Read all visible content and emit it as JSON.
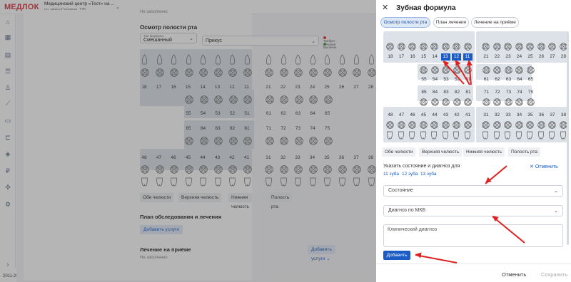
{
  "app": {
    "logo": "МЕДЛОК",
    "clinic": "Медицинский центр «Тест» на ...",
    "clinic_addr": "ул. Ново-Садовая, 135",
    "footer": "2011-2026 © медрокет"
  },
  "bg": {
    "not_filled_top": "Не заполнено",
    "exam_title": "Осмотр полости рта",
    "formula_type_label": "Тип формулы",
    "formula_type_value": "Смешанный",
    "bite_value": "Прикус",
    "legend_required": "Требует лечения",
    "legend_extracted": "Выпечен",
    "legend_colors": {
      "required": "#e0303a",
      "extracted": "#3aa047"
    },
    "upper_perm": [
      "18",
      "17",
      "16",
      "15",
      "14",
      "13",
      "12",
      "11",
      "21",
      "22",
      "23",
      "24",
      "25",
      "26",
      "27",
      "28"
    ],
    "upper_milk": [
      "55",
      "54",
      "53",
      "52",
      "51",
      "61",
      "62",
      "63",
      "64",
      "65"
    ],
    "lower_milk": [
      "85",
      "84",
      "83",
      "82",
      "81",
      "71",
      "72",
      "73",
      "74",
      "75"
    ],
    "lower_perm": [
      "48",
      "47",
      "46",
      "45",
      "44",
      "43",
      "42",
      "41",
      "31",
      "32",
      "33",
      "34",
      "35",
      "36",
      "37",
      "38"
    ],
    "jaw_buttons": [
      "Обе челюсти",
      "Верхняя челюсть",
      "Нижняя челюсть",
      "Полость рта"
    ],
    "plan_title": "План обследования и лечения",
    "add_services": "Добавить услуги",
    "treatment_title": "Лечение на приёме",
    "add_services2": "Добавить услуги",
    "not_filled": "Не заполнено"
  },
  "panel": {
    "title": "Зубная формула",
    "tabs": [
      "Осмотр полости рта",
      "План лечения",
      "Лечение на приёме"
    ],
    "upper_perm": [
      "18",
      "17",
      "16",
      "15",
      "14",
      "13",
      "12",
      "11",
      "21",
      "22",
      "23",
      "24",
      "25",
      "26",
      "27",
      "28"
    ],
    "upper_milk": [
      "55",
      "54",
      "53",
      "52",
      "51",
      "61",
      "62",
      "63",
      "64",
      "65"
    ],
    "lower_milk": [
      "85",
      "84",
      "83",
      "82",
      "81",
      "71",
      "72",
      "73",
      "74",
      "75"
    ],
    "lower_perm": [
      "48",
      "47",
      "46",
      "45",
      "44",
      "43",
      "42",
      "41",
      "31",
      "32",
      "33",
      "34",
      "35",
      "36",
      "37",
      "38"
    ],
    "selected_teeth": [
      "13",
      "12",
      "11"
    ],
    "jaw_buttons": [
      "Обе челюсти",
      "Верхняя челюсть",
      "Нижняя челюсть",
      "Полость рта"
    ],
    "state_heading": "Указать состояние и диагноз для",
    "reset": "Отменить",
    "chips": [
      "11 зуба",
      "12 зуба",
      "13 зуба"
    ],
    "state_placeholder": "Состояние",
    "mkb_placeholder": "Диагноз по МКБ",
    "clinical_placeholder": "Клинический диагноз",
    "add": "Добавить",
    "cancel": "Отменить",
    "save": "Сохранить"
  },
  "colors": {
    "accent": "#1b5cc4",
    "arrow": "#e02020"
  }
}
